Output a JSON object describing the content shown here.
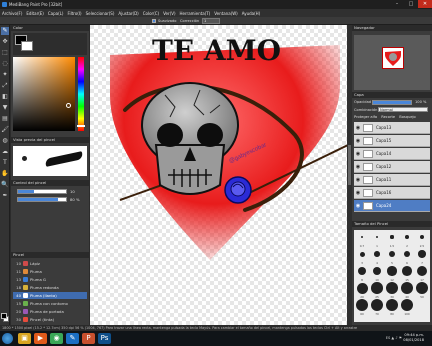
{
  "window": {
    "title": "MediBang Paint Pro [32bit]",
    "minimize": "–",
    "maximize": "□",
    "close": "✕"
  },
  "menu": [
    "Archivo(F)",
    "Editar(E)",
    "Capa(L)",
    "Filtro(I)",
    "Seleccionar(S)",
    "Ajustar(D)",
    "Color(C)",
    "Ver(V)",
    "Herramienta(T)",
    "Ventana(W)",
    "Ayuda(H)"
  ],
  "options": {
    "antialias_label": "Suavizado",
    "correction_label": "Corrección",
    "correction_value": "1"
  },
  "tools": [
    "pen-icon",
    "move-icon",
    "select-icon",
    "lasso-icon",
    "magic-wand-icon",
    "transform-icon",
    "eraser-icon",
    "bucket-icon",
    "gradient-icon",
    "brush-icon",
    "blur-icon",
    "smudge-icon",
    "text-icon",
    "hand-icon",
    "zoom-icon",
    "eyedropper-icon"
  ],
  "tool_glyphs": [
    "✎",
    "✥",
    "⬚",
    "◌",
    "✦",
    "⤢",
    "◧",
    "▼",
    "▤",
    "🖌",
    "◍",
    "☁",
    "T",
    "✋",
    "🔍",
    "✒"
  ],
  "panels": {
    "color_title": "Color",
    "brush_preview_title": "Vista previa del pincel",
    "brush_control_title": "Control del pincel",
    "brush_size_value": "10",
    "brush_opacity_value": "80 %",
    "brush_list_title": "Pincel",
    "navigator_title": "Navegador",
    "layer_title": "Capa",
    "opacity_label": "Opacidad",
    "opacity_value": "100 %",
    "blend_label": "Combinación",
    "blend_value": "Normal",
    "protect_alpha": "Proteger alfa",
    "clipping": "Recorte",
    "sketch": "Bosquejo",
    "brush_size_title": "Tamaño del Pincel"
  },
  "brushes": [
    {
      "size": "10",
      "name": "Lápiz",
      "color": "#d04a4a"
    },
    {
      "size": "11",
      "name": "Pluma",
      "color": "#e08a3a"
    },
    {
      "size": "13",
      "name": "Pluma G",
      "color": "#3a7dd8"
    },
    {
      "size": "18",
      "name": "Pluma redonda",
      "color": "#d8b23a"
    },
    {
      "size": "40",
      "name": "Pluma (Ilanta)",
      "color": "#ffffff"
    },
    {
      "size": "15",
      "name": "Pluma con contorno",
      "color": "#6ab04c"
    },
    {
      "size": "20",
      "name": "Pluma de portada",
      "color": "#9b59b6"
    },
    {
      "size": "30",
      "name": "Pincel (tinta)",
      "color": "#e74c3c"
    }
  ],
  "selected_brush_index": 4,
  "layers": [
    "Capa13",
    "Capa15",
    "Capa14",
    "Capa12",
    "Capa11",
    "Capa16",
    "Capa24"
  ],
  "selected_layer_index": 6,
  "brush_sizes": [
    "0.7",
    "1",
    "1.5",
    "2",
    "2.5",
    "3",
    "4",
    "5",
    "6",
    "7",
    "8",
    "10",
    "12",
    "15",
    "17",
    "20",
    "25",
    "30",
    "40",
    "50",
    "60",
    "70",
    "80",
    "100"
  ],
  "canvas": {
    "text": "TE AMO",
    "watermark": "@gabyescobar"
  },
  "status": "1800 * 1500 pixel  (15.2 * 12.7cm)  350 dpi  56 %  (1004, 767)  Para trazar una línea recta, mantenga pulsada la tecla Mayús. Para cambiar el tamaño del pincel, mantenga pulsadas las teclas Ctrl + Alt y arrastre",
  "taskbar": {
    "apps": [
      "file-explorer-icon",
      "media-player-icon",
      "chrome-icon",
      "medibang-icon",
      "powerpoint-icon",
      "photoshop-icon"
    ],
    "app_glyphs": [
      "▣",
      "▶",
      "◉",
      "✎",
      "P",
      "Ps"
    ],
    "app_colors": [
      "#d9a521",
      "#e05a1a",
      "#3aa757",
      "#1b6ec2",
      "#c8502e",
      "#0e4f8a"
    ],
    "time": "09:44 p.m.",
    "date": "08/01/2018",
    "tray": "ES ▲ ♪ ⚑"
  },
  "colors": {
    "heart": "#e81c1c",
    "accent": "#3f6cb0",
    "current_fg": "#000000"
  }
}
